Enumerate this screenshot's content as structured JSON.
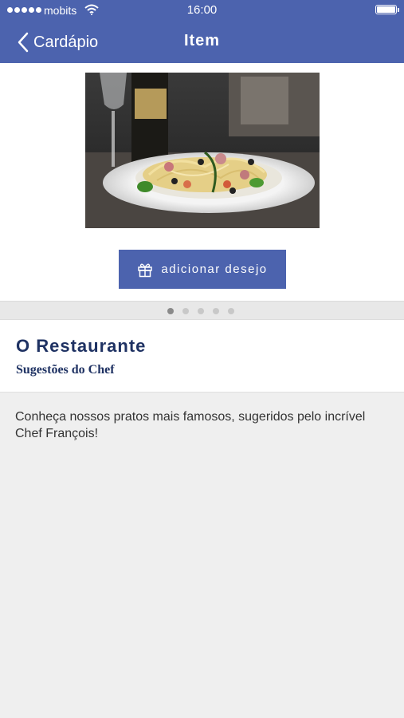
{
  "status_bar": {
    "carrier": "mobits",
    "time": "16:00",
    "signal_icon": "signal-dots-icon",
    "wifi_icon": "wifi-icon",
    "battery_icon": "battery-icon"
  },
  "nav": {
    "back_label": "Cardápio",
    "title": "Item"
  },
  "item": {
    "photo_alt": "pasta-dish-photo",
    "wish_button_label": "adicionar desejo",
    "wish_icon": "gift-icon",
    "page_indicator": {
      "count": 5,
      "active_index": 0
    },
    "title": "O Restaurante",
    "subtitle": "Sugestões do Chef",
    "description": "Conheça nossos pratos mais famosos, sugeridos pelo incrível Chef François!"
  },
  "colors": {
    "brand": "#4c63ae",
    "title_text": "#1f3263",
    "background": "#efefef"
  }
}
